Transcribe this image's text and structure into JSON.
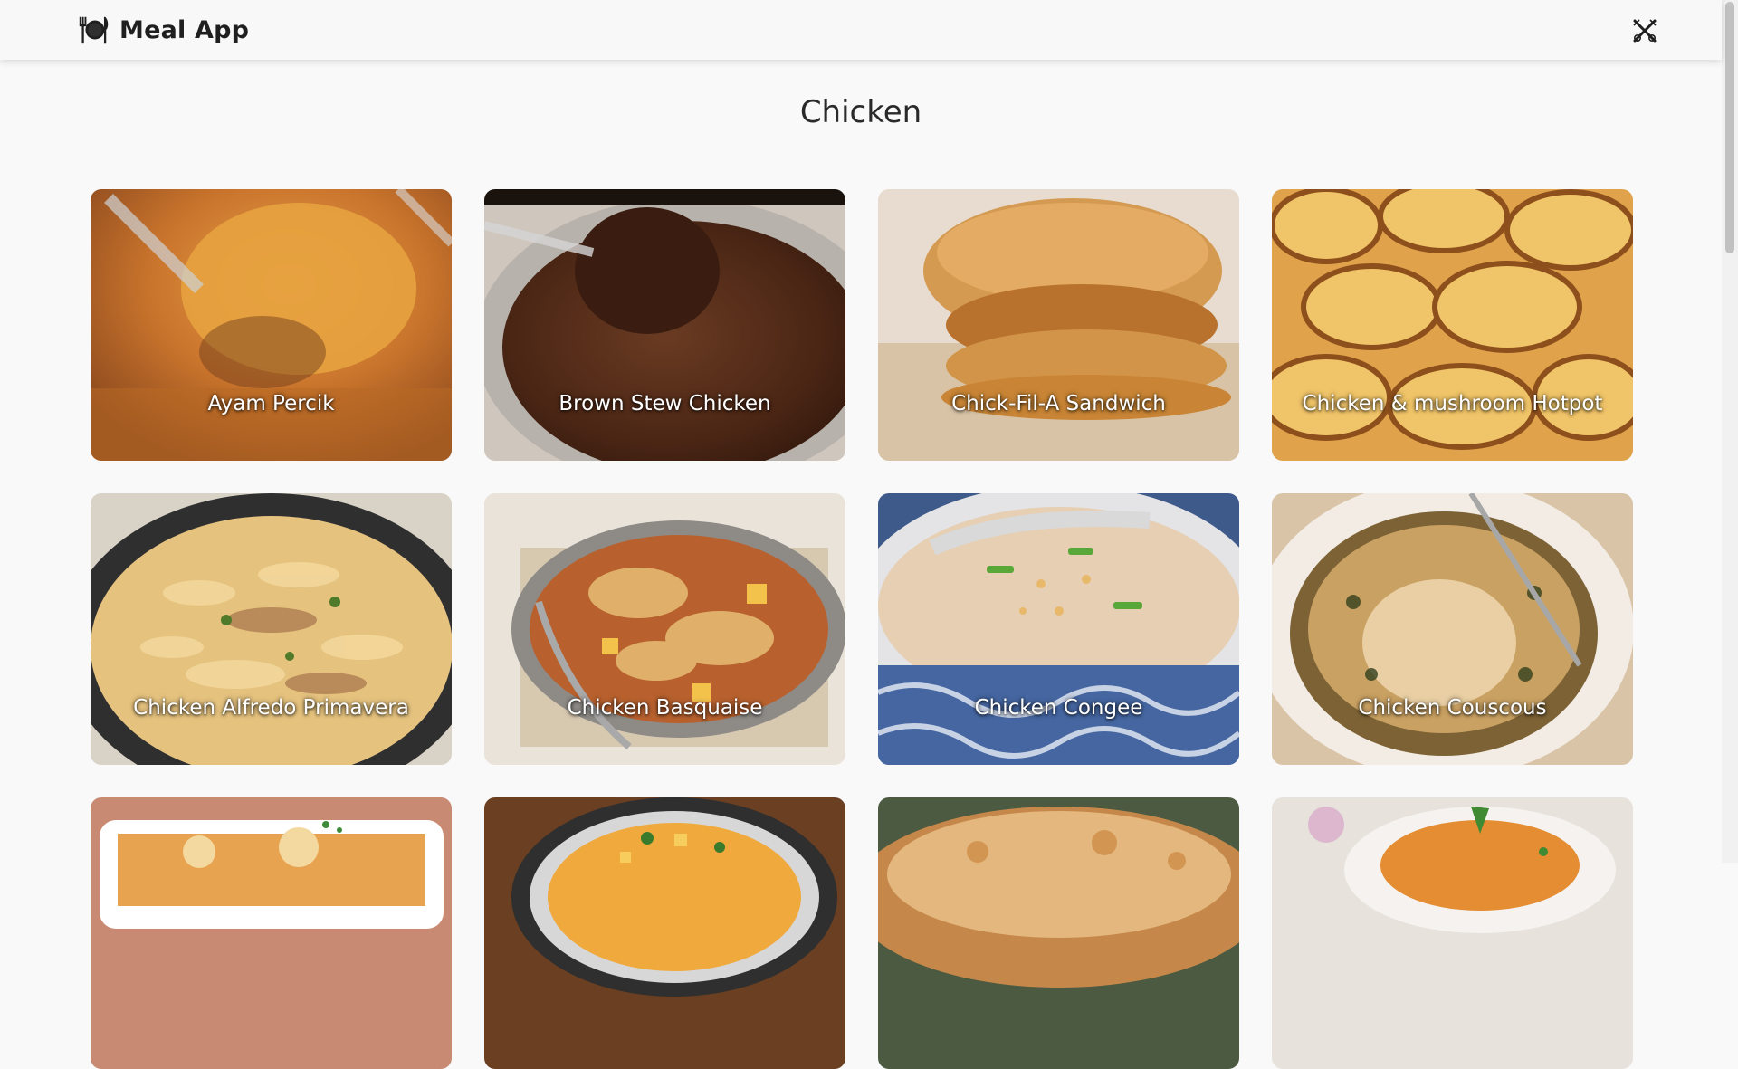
{
  "navbar": {
    "brand_name": "Meal App",
    "brand_icon": "plate-cutlery-icon",
    "toggle_icon": "crossed-utensils-icon"
  },
  "page": {
    "title": "Chicken"
  },
  "meals": [
    {
      "name": "Ayam Percik"
    },
    {
      "name": "Brown Stew Chicken"
    },
    {
      "name": "Chick-Fil-A Sandwich"
    },
    {
      "name": "Chicken & mushroom Hotpot"
    },
    {
      "name": "Chicken Alfredo Primavera"
    },
    {
      "name": "Chicken Basquaise"
    },
    {
      "name": "Chicken Congee"
    },
    {
      "name": "Chicken Couscous"
    },
    {
      "name": ""
    },
    {
      "name": ""
    },
    {
      "name": ""
    },
    {
      "name": ""
    }
  ],
  "colors": {
    "background": "#f9f9f9",
    "navbar": "#f8f8f8",
    "text": "#222222",
    "label": "#ffffff"
  }
}
